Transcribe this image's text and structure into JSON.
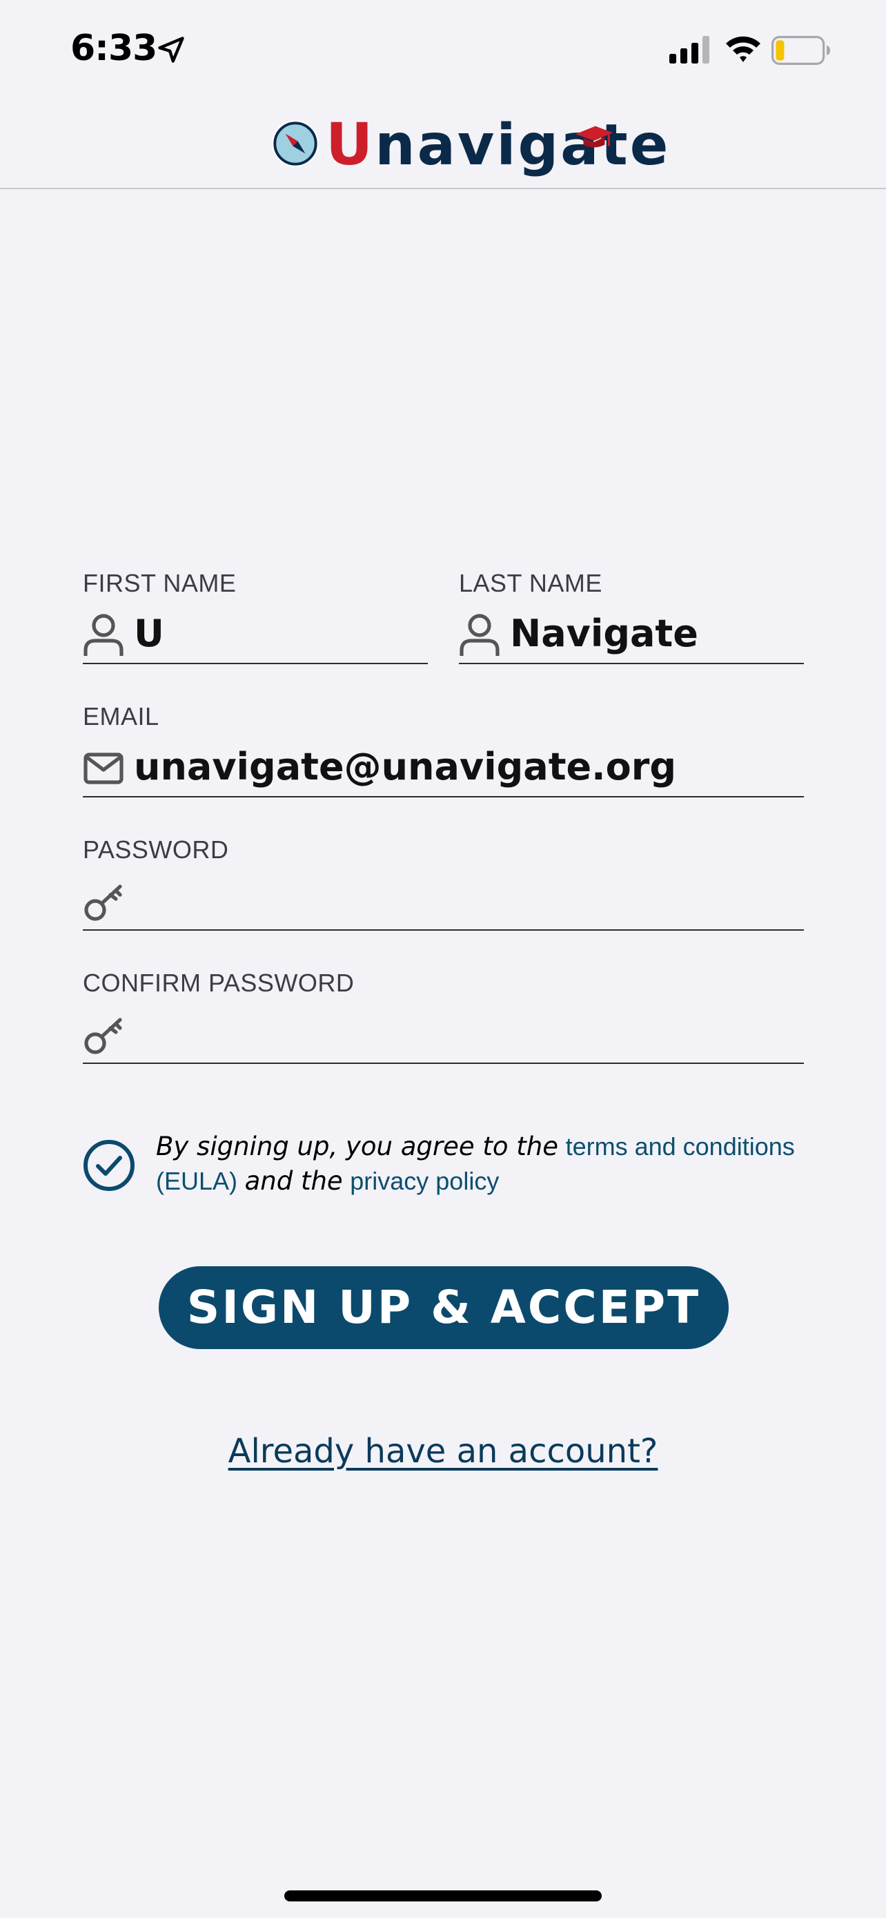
{
  "status_bar": {
    "time": "6:33",
    "battery_color": "#f5c400"
  },
  "header": {
    "logo_first": "U",
    "logo_rest": "navigate"
  },
  "form": {
    "first_name": {
      "label": "FIRST NAME",
      "value": "U"
    },
    "last_name": {
      "label": "LAST NAME",
      "value": "Navigate"
    },
    "email": {
      "label": "EMAIL",
      "value": "unavigate@unavigate.org"
    },
    "password": {
      "label": "PASSWORD",
      "value": ""
    },
    "confirm_password": {
      "label": "CONFIRM PASSWORD",
      "value": ""
    }
  },
  "agreement": {
    "checked": true,
    "text_1": "By signing up, you agree to the",
    "terms_link": "terms and conditions (EULA)",
    "text_2": "and the",
    "privacy_link": "privacy policy"
  },
  "signup_button": "SIGN UP & ACCEPT",
  "login_link": "Already have an account?",
  "colors": {
    "primary": "#0b4a6c",
    "brand_red": "#cc1f2a",
    "brand_navy": "#0b2a4a",
    "link": "#0d4e6e"
  }
}
